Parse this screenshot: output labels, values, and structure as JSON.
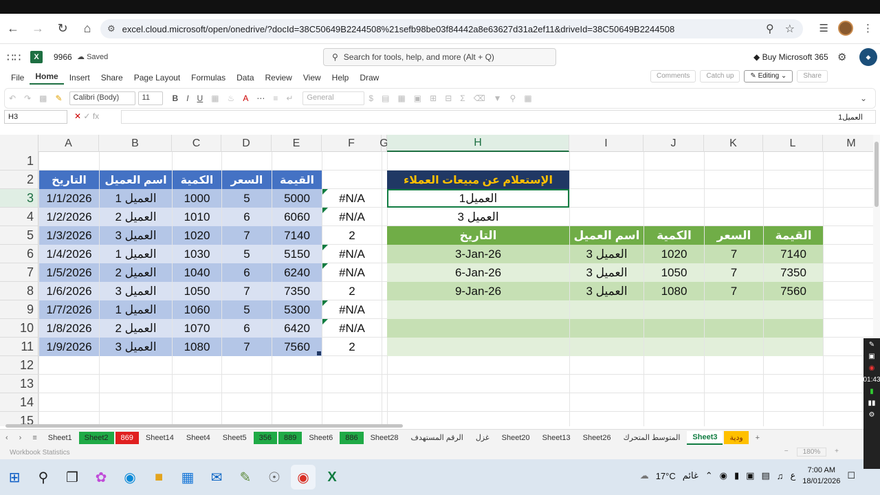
{
  "browser": {
    "url": "excel.cloud.microsoft/open/onedrive/?docId=38C50649B2244508%21sefb98be03f84442a8e63627d31a2ef11&driveId=38C50649B2244508"
  },
  "app": {
    "doc_name": "9966",
    "saved_label": "Saved",
    "search_placeholder": "Search for tools, help, and more (Alt + Q)",
    "buy_label": "Buy Microsoft 365"
  },
  "menu": {
    "items": [
      "File",
      "Home",
      "Insert",
      "Share",
      "Page Layout",
      "Formulas",
      "Data",
      "Review",
      "View",
      "Help",
      "Draw"
    ],
    "active": "Home",
    "comments": "Comments",
    "catchup": "Catch up",
    "editing": "Editing",
    "share": "Share"
  },
  "toolbar": {
    "font": "Calibri (Body)",
    "font_size": "11",
    "number_format": "General"
  },
  "formula_bar": {
    "name_box": "H3",
    "content": "العميل1"
  },
  "columns": [
    "A",
    "B",
    "C",
    "D",
    "E",
    "F",
    "G",
    "H",
    "I",
    "J",
    "K",
    "L",
    "M"
  ],
  "rows": [
    "1",
    "2",
    "3",
    "4",
    "5",
    "6",
    "7",
    "8",
    "9",
    "10",
    "11",
    "12",
    "13",
    "14",
    "15"
  ],
  "table1": {
    "headers": [
      "التاريخ",
      "اسم العميل",
      "الكمية",
      "السعر",
      "القيمة"
    ],
    "rows": [
      [
        "1/1/2026",
        "العميل 1",
        "1000",
        "5",
        "5000",
        "#N/A"
      ],
      [
        "1/2/2026",
        "العميل 2",
        "1010",
        "6",
        "6060",
        "#N/A"
      ],
      [
        "1/3/2026",
        "العميل 3",
        "1020",
        "7",
        "7140",
        "2"
      ],
      [
        "1/4/2026",
        "العميل 1",
        "1030",
        "5",
        "5150",
        "#N/A"
      ],
      [
        "1/5/2026",
        "العميل 2",
        "1040",
        "6",
        "6240",
        "#N/A"
      ],
      [
        "1/6/2026",
        "العميل 3",
        "1050",
        "7",
        "7350",
        "2"
      ],
      [
        "1/7/2026",
        "العميل 1",
        "1060",
        "5",
        "5300",
        "#N/A"
      ],
      [
        "1/8/2026",
        "العميل 2",
        "1070",
        "6",
        "6420",
        "#N/A"
      ],
      [
        "1/9/2026",
        "العميل 3",
        "1080",
        "7",
        "7560",
        "2"
      ]
    ]
  },
  "query": {
    "title": "الإستعلام عن مبيعات العملاء",
    "input": "العميل1",
    "value": "العميل 3",
    "headers": [
      "التاريخ",
      "اسم العميل",
      "الكمية",
      "السعر",
      "القيمة"
    ],
    "rows": [
      [
        "3-Jan-26",
        "العميل 3",
        "1020",
        "7",
        "7140"
      ],
      [
        "6-Jan-26",
        "العميل 3",
        "1050",
        "7",
        "7350"
      ],
      [
        "9-Jan-26",
        "العميل 3",
        "1080",
        "7",
        "7560"
      ]
    ]
  },
  "sheet_tabs": [
    {
      "name": "Sheet1",
      "style": "plain"
    },
    {
      "name": "Sheet2",
      "style": "green"
    },
    {
      "name": "869",
      "style": "red"
    },
    {
      "name": "Sheet14",
      "style": "plain"
    },
    {
      "name": "Sheet4",
      "style": "plain"
    },
    {
      "name": "Sheet5",
      "style": "plain"
    },
    {
      "name": "356",
      "style": "green"
    },
    {
      "name": "889",
      "style": "green"
    },
    {
      "name": "Sheet6",
      "style": "plain"
    },
    {
      "name": "886",
      "style": "green"
    },
    {
      "name": "Sheet28",
      "style": "plain"
    },
    {
      "name": "الرقم المستهدف",
      "style": "plain"
    },
    {
      "name": "غزل",
      "style": "plain"
    },
    {
      "name": "Sheet20",
      "style": "plain"
    },
    {
      "name": "Sheet13",
      "style": "plain"
    },
    {
      "name": "Sheet26",
      "style": "plain"
    },
    {
      "name": "المتوسط المتحرك",
      "style": "plain"
    },
    {
      "name": "Sheet3",
      "style": "active"
    },
    {
      "name": "ودية",
      "style": "yellow"
    }
  ],
  "status": {
    "left": "Workbook Statistics",
    "zoom": "180%"
  },
  "taskbar": {
    "weather_temp": "17°C",
    "weather_text": "غائم",
    "time": "7:00 AM",
    "date": "18/01/2026",
    "lang": "ع"
  },
  "recorder": {
    "timer": "01:43"
  },
  "colors": {
    "excel_green": "#107c41",
    "table_header_blue": "#4472c4",
    "band_dark": "#b4c6e7",
    "band_light": "#d9e1f2",
    "query_title_bg": "#203864",
    "query_title_text": "#ffc000",
    "result_header_green": "#70ad47"
  }
}
